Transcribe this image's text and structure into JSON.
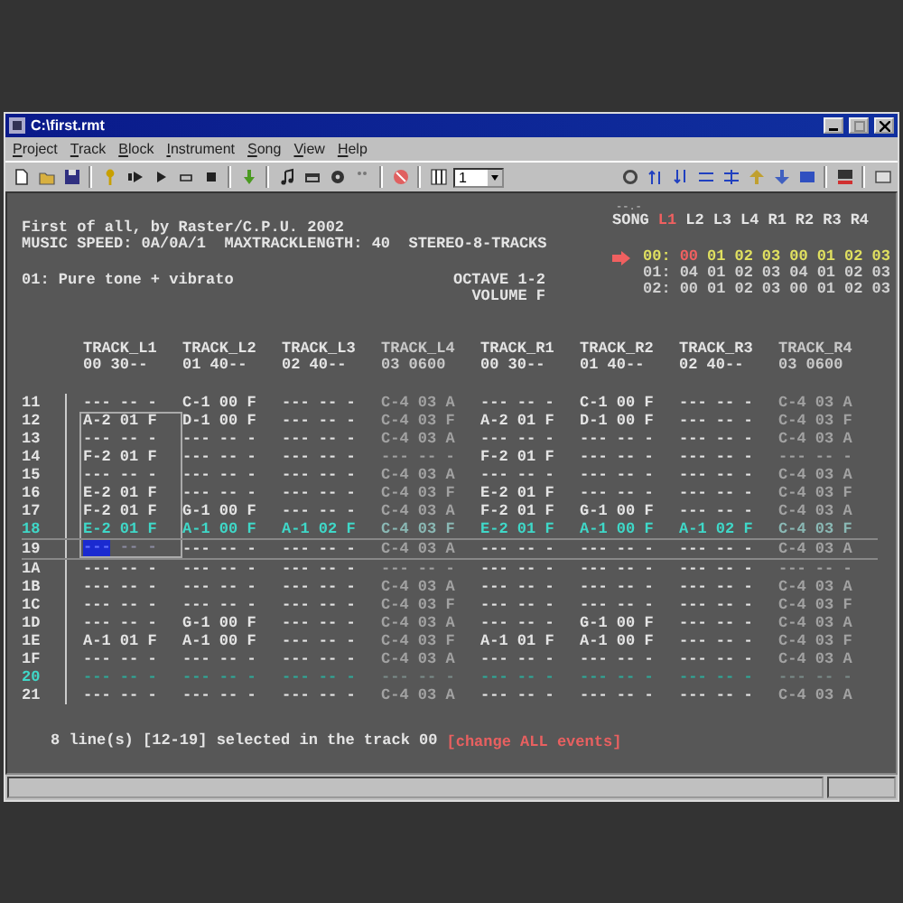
{
  "window": {
    "title": "C:\\first.rmt"
  },
  "menu": [
    "Project",
    "Track",
    "Block",
    "Instrument",
    "Song",
    "View",
    "Help"
  ],
  "toolbar": {
    "select_value": "1"
  },
  "info": {
    "song_name": "First of all, by Raster/C.P.U. 2002",
    "speed_line": "MUSIC SPEED: 0A/0A/1  MAXTRACKLENGTH: 40  STEREO-8-TRACKS",
    "instrument": "01: Pure tone + vibrato",
    "octave": "OCTAVE 1-2",
    "volume": "VOLUME F"
  },
  "song": {
    "marker": "--.-",
    "label": "SONG",
    "columns": [
      {
        "label": "L1",
        "selected": true
      },
      {
        "label": "L2",
        "selected": false
      },
      {
        "label": "L3",
        "selected": false
      },
      {
        "label": "L4",
        "selected": false
      },
      {
        "label": "R1",
        "selected": false
      },
      {
        "label": "R2",
        "selected": false
      },
      {
        "label": "R3",
        "selected": false
      },
      {
        "label": "R4",
        "selected": false
      }
    ],
    "lines": [
      {
        "index": "00:",
        "current": true,
        "values": [
          "00",
          "01",
          "02",
          "03",
          "00",
          "01",
          "02",
          "03"
        ]
      },
      {
        "index": "01:",
        "current": false,
        "values": [
          "04",
          "01",
          "02",
          "03",
          "04",
          "01",
          "02",
          "03"
        ]
      },
      {
        "index": "02:",
        "current": false,
        "values": [
          "00",
          "01",
          "02",
          "03",
          "00",
          "01",
          "02",
          "03"
        ]
      }
    ]
  },
  "tracks": [
    {
      "name": "TRACK_L1",
      "info": "00 30--",
      "muted": false,
      "selected": true
    },
    {
      "name": "TRACK_L2",
      "info": "01 40--",
      "muted": false,
      "selected": false
    },
    {
      "name": "TRACK_L3",
      "info": "02 40--",
      "muted": false,
      "selected": false
    },
    {
      "name": "TRACK_L4",
      "info": "03 0600",
      "muted": true,
      "selected": false
    },
    {
      "name": "TRACK_R1",
      "info": "00 30--",
      "muted": false,
      "selected": false
    },
    {
      "name": "TRACK_R2",
      "info": "01 40--",
      "muted": false,
      "selected": false
    },
    {
      "name": "TRACK_R3",
      "info": "02 40--",
      "muted": false,
      "selected": false
    },
    {
      "name": "TRACK_R4",
      "info": "03 0600",
      "muted": true,
      "selected": false
    }
  ],
  "rows": [
    {
      "line": "11",
      "kind": "normal",
      "in_selection": false,
      "cells": [
        "--- -- -",
        "C-1 00 F",
        "--- -- -",
        "C-4 03 A",
        "--- -- -",
        "C-1 00 F",
        "--- -- -",
        "C-4 03 A"
      ]
    },
    {
      "line": "12",
      "kind": "normal",
      "in_selection": true,
      "cells": [
        "A-2 01 F",
        "D-1 00 F",
        "--- -- -",
        "C-4 03 F",
        "A-2 01 F",
        "D-1 00 F",
        "--- -- -",
        "C-4 03 F"
      ]
    },
    {
      "line": "13",
      "kind": "normal",
      "in_selection": true,
      "cells": [
        "--- -- -",
        "--- -- -",
        "--- -- -",
        "C-4 03 A",
        "--- -- -",
        "--- -- -",
        "--- -- -",
        "C-4 03 A"
      ]
    },
    {
      "line": "14",
      "kind": "normal",
      "in_selection": true,
      "cells": [
        "F-2 01 F",
        "--- -- -",
        "--- -- -",
        "--- -- -",
        "F-2 01 F",
        "--- -- -",
        "--- -- -",
        "--- -- -"
      ]
    },
    {
      "line": "15",
      "kind": "normal",
      "in_selection": true,
      "cells": [
        "--- -- -",
        "--- -- -",
        "--- -- -",
        "C-4 03 A",
        "--- -- -",
        "--- -- -",
        "--- -- -",
        "C-4 03 A"
      ]
    },
    {
      "line": "16",
      "kind": "normal",
      "in_selection": true,
      "cells": [
        "E-2 01 F",
        "--- -- -",
        "--- -- -",
        "C-4 03 F",
        "E-2 01 F",
        "--- -- -",
        "--- -- -",
        "C-4 03 F"
      ]
    },
    {
      "line": "17",
      "kind": "normal",
      "in_selection": true,
      "cells": [
        "F-2 01 F",
        "G-1 00 F",
        "--- -- -",
        "C-4 03 A",
        "F-2 01 F",
        "G-1 00 F",
        "--- -- -",
        "C-4 03 A"
      ]
    },
    {
      "line": "18",
      "kind": "play",
      "in_selection": true,
      "cells": [
        "E-2 01 F",
        "A-1 00 F",
        "A-1 02 F",
        "C-4 03 F",
        "E-2 01 F",
        "A-1 00 F",
        "A-1 02 F",
        "C-4 03 F"
      ]
    },
    {
      "line": "19",
      "kind": "cursor",
      "in_selection": true,
      "cells": [
        "--- -- -",
        "--- -- -",
        "--- -- -",
        "C-4 03 A",
        "--- -- -",
        "--- -- -",
        "--- -- -",
        "C-4 03 A"
      ]
    },
    {
      "line": "1A",
      "kind": "normal",
      "in_selection": false,
      "cells": [
        "--- -- -",
        "--- -- -",
        "--- -- -",
        "--- -- -",
        "--- -- -",
        "--- -- -",
        "--- -- -",
        "--- -- -"
      ]
    },
    {
      "line": "1B",
      "kind": "normal",
      "in_selection": false,
      "cells": [
        "--- -- -",
        "--- -- -",
        "--- -- -",
        "C-4 03 A",
        "--- -- -",
        "--- -- -",
        "--- -- -",
        "C-4 03 A"
      ]
    },
    {
      "line": "1C",
      "kind": "normal",
      "in_selection": false,
      "cells": [
        "--- -- -",
        "--- -- -",
        "--- -- -",
        "C-4 03 F",
        "--- -- -",
        "--- -- -",
        "--- -- -",
        "C-4 03 F"
      ]
    },
    {
      "line": "1D",
      "kind": "normal",
      "in_selection": false,
      "cells": [
        "--- -- -",
        "G-1 00 F",
        "--- -- -",
        "C-4 03 A",
        "--- -- -",
        "G-1 00 F",
        "--- -- -",
        "C-4 03 A"
      ]
    },
    {
      "line": "1E",
      "kind": "normal",
      "in_selection": false,
      "cells": [
        "A-1 01 F",
        "A-1 00 F",
        "--- -- -",
        "C-4 03 F",
        "A-1 01 F",
        "A-1 00 F",
        "--- -- -",
        "C-4 03 F"
      ]
    },
    {
      "line": "1F",
      "kind": "normal",
      "in_selection": false,
      "cells": [
        "--- -- -",
        "--- -- -",
        "--- -- -",
        "C-4 03 A",
        "--- -- -",
        "--- -- -",
        "--- -- -",
        "C-4 03 A"
      ]
    },
    {
      "line": "20",
      "kind": "beat",
      "in_selection": false,
      "cells": [
        "--- -- -",
        "--- -- -",
        "--- -- -",
        "--- -- -",
        "--- -- -",
        "--- -- -",
        "--- -- -",
        "--- -- -"
      ]
    },
    {
      "line": "21",
      "kind": "normal",
      "in_selection": false,
      "cells": [
        "--- -- -",
        "--- -- -",
        "--- -- -",
        "C-4 03 A",
        "--- -- -",
        "--- -- -",
        "--- -- -",
        "C-4 03 A"
      ]
    }
  ],
  "status": {
    "message": "8 line(s) [12-19] selected in the track 00",
    "action": "[change ALL events]"
  }
}
